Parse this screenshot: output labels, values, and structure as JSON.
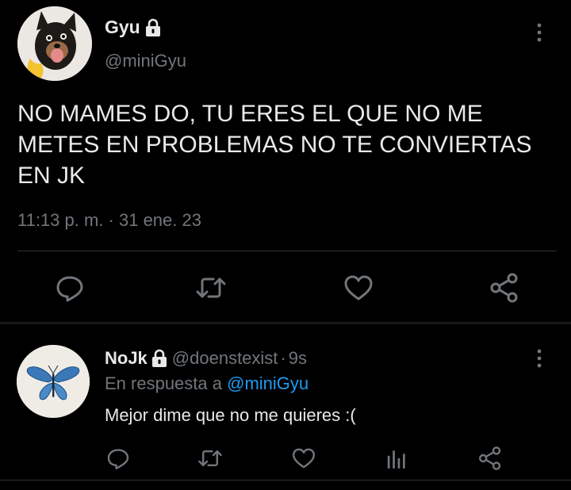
{
  "main_tweet": {
    "name": "Gyu",
    "handle": "@miniGyu",
    "text": "NO MAMES DO, TU ERES EL QUE NO ME METES EN PROBLEMAS NO TE CONVIERTAS EN JK",
    "timestamp": "11:13 p. m. · 31 ene. 23",
    "icons": [
      "lock-icon",
      "more-vertical-icon",
      "reply-icon",
      "retweet-icon",
      "like-icon",
      "share-icon"
    ]
  },
  "reply_tweet": {
    "name": "NoJk",
    "handle": "@doenstexist",
    "separator": "·",
    "time_ago": "9s",
    "replying_prefix": "En respuesta a",
    "replying_to": "@miniGyu",
    "text": "Mejor dime que no me quieres :(",
    "icons": [
      "lock-icon",
      "more-vertical-icon",
      "reply-icon",
      "retweet-icon",
      "like-icon",
      "analytics-icon",
      "share-icon"
    ]
  },
  "colors": {
    "background": "#000000",
    "text_primary": "#e7e9ea",
    "text_secondary": "#71767b",
    "accent": "#1d9bf0",
    "divider": "#2f3336"
  }
}
